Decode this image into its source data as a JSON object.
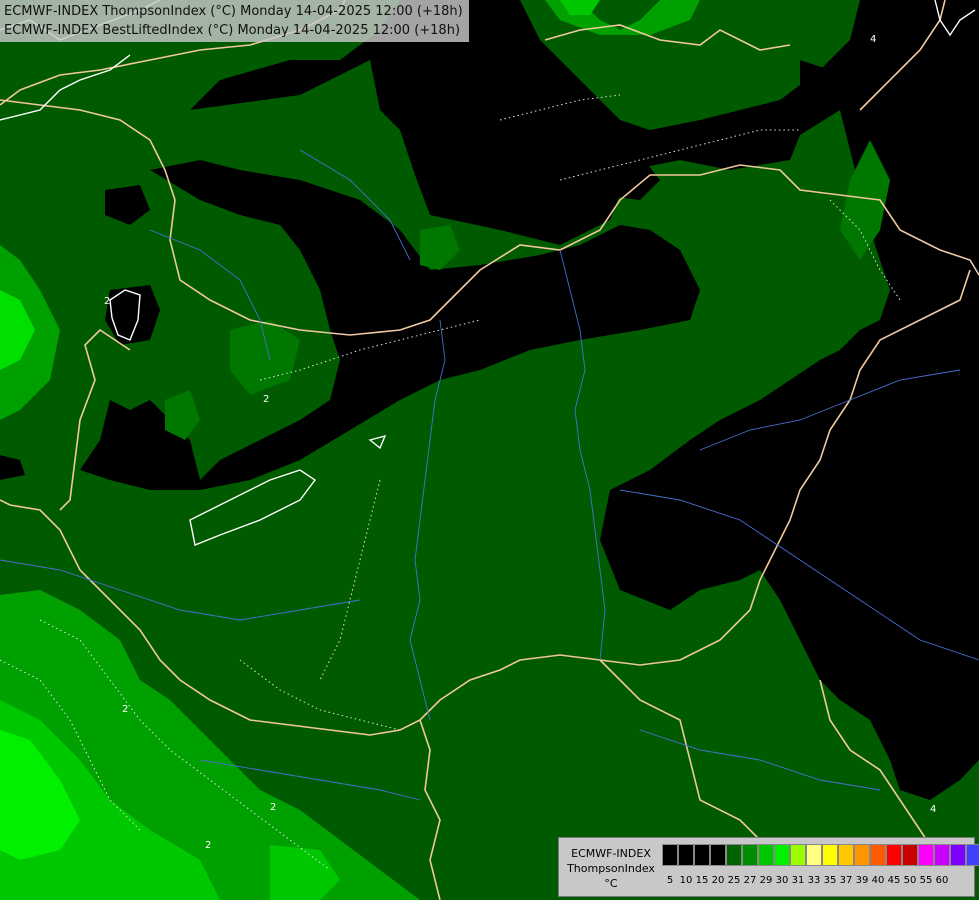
{
  "header": {
    "line1": "ECMWF-INDEX ThompsonIndex (°C) Monday 14-04-2025 12:00 (+18h)",
    "line2": "ECMWF-INDEX BestLiftedIndex (°C) Monday 14-04-2025 12:00 (+18h)"
  },
  "legend": {
    "line1": "ECMWF-INDEX",
    "line2": "ThompsonIndex",
    "unit": "°C",
    "colors": [
      "#000000",
      "#000000",
      "#000000",
      "#000000",
      "#006400",
      "#008c00",
      "#00c800",
      "#00f000",
      "#9bff00",
      "#ffff80",
      "#ffff00",
      "#ffc800",
      "#ff9600",
      "#ff5a00",
      "#ff0000",
      "#c80000",
      "#ff00ff",
      "#c800ff",
      "#8000ff",
      "#4040ff",
      "#0000ff"
    ],
    "ticks": [
      "5",
      "10",
      "15",
      "20",
      "25",
      "27",
      "29",
      "30",
      "31",
      "33",
      "35",
      "37",
      "39",
      "40",
      "45",
      "50",
      "55",
      "60"
    ]
  },
  "contour_labels": [
    "2",
    "2",
    "2",
    "2",
    "2",
    "4",
    "4"
  ]
}
